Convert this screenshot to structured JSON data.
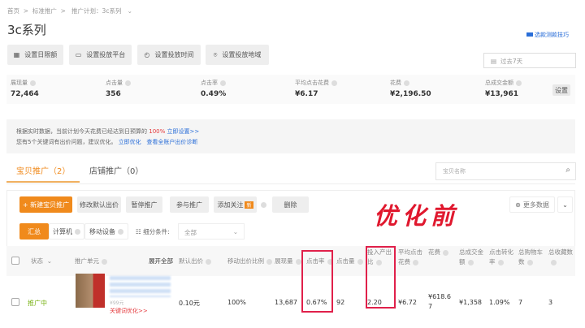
{
  "breadcrumb": [
    "首页",
    "标准推广",
    "推广计划：3c系列"
  ],
  "title": "3c系列",
  "help_link": "选款测款技巧",
  "actions": [
    "设置日限额",
    "设置投放平台",
    "设置投放时间",
    "设置投放地域"
  ],
  "date_range": "过去7天",
  "metrics": [
    {
      "label": "展现量",
      "value": "72,464"
    },
    {
      "label": "点击量",
      "value": "356"
    },
    {
      "label": "点击率",
      "value": "0.49%"
    },
    {
      "label": "平均点击花费",
      "value": "¥6.17"
    },
    {
      "label": "花费",
      "value": "¥2,196.50"
    },
    {
      "label": "总成交金额",
      "value": "¥13,961"
    }
  ],
  "metrics_settings": "设置",
  "notice": {
    "line1_pre": "根据实时数据，当前计划今天花费已经达到日预算的",
    "line1_pct": "100%",
    "line1_link": "立即设置>>",
    "line2_pre": "您有5个关键词有出价问题，建议优化。",
    "line2_link1": "立即优化",
    "line2_link2": "查看全账户出价诊断"
  },
  "tabs": [
    {
      "label": "宝贝推广（2）"
    },
    {
      "label": "店铺推广（0）"
    }
  ],
  "search_placeholder": "宝贝名称",
  "toolbar": {
    "new": "+ 新建宝贝推广",
    "edit_bid": "修改默认出价",
    "pause": "暂停推广",
    "join": "参与推广",
    "follow": "添加关注",
    "follow_badge": "新",
    "delete": "删除",
    "more": "更多数据"
  },
  "annotation": "优化前",
  "segments": [
    "汇总",
    "计算机",
    "移动设备"
  ],
  "filter_label": "细分条件:",
  "filter_value": "全部",
  "table": {
    "headers": [
      "状态",
      "推广单元",
      "展开全部",
      "默认出价",
      "移动出价比例",
      "展现量",
      "点击率",
      "点击量",
      "投入产出比",
      "平均点击花费",
      "花费",
      "总成交金额",
      "点击转化率",
      "总购物车数",
      "总收藏数"
    ],
    "row": {
      "status": "推广中",
      "price": "¥99元",
      "keyword_link": "关键词优化>>",
      "bid": "0.10元",
      "mobile_ratio": "100%",
      "impressions": "13,687",
      "ctr": "0.67%",
      "clicks": "92",
      "roi": "2.20",
      "avg_cpc": "¥6.72",
      "cost": "¥618.67",
      "gmv": "¥1,358",
      "cvr": "1.09%",
      "cart": "7",
      "fav": "3"
    }
  }
}
